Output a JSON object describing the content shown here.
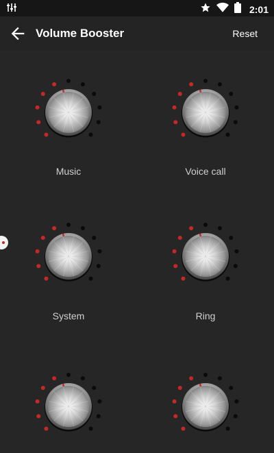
{
  "status_bar": {
    "time": "2:01",
    "left_icon": "equalizer-icon",
    "icons": [
      "star-icon",
      "wifi-icon",
      "battery-icon"
    ]
  },
  "app_bar": {
    "title": "Volume Booster",
    "back_icon": "arrow-back-icon",
    "reset_label": "Reset"
  },
  "colors": {
    "background": "#262626",
    "status_bar": "#161616",
    "active_dot": "#c62828",
    "inactive_dot": "#0a0a0a",
    "label": "#d0d0d0"
  },
  "knobs": [
    {
      "label": "Music",
      "level": 0.45
    },
    {
      "label": "Voice call",
      "level": 0.45
    },
    {
      "label": "System",
      "level": 0.45
    },
    {
      "label": "Ring",
      "level": 0.45
    },
    {
      "label": "",
      "level": 0.45
    },
    {
      "label": "",
      "level": 0.45
    }
  ]
}
